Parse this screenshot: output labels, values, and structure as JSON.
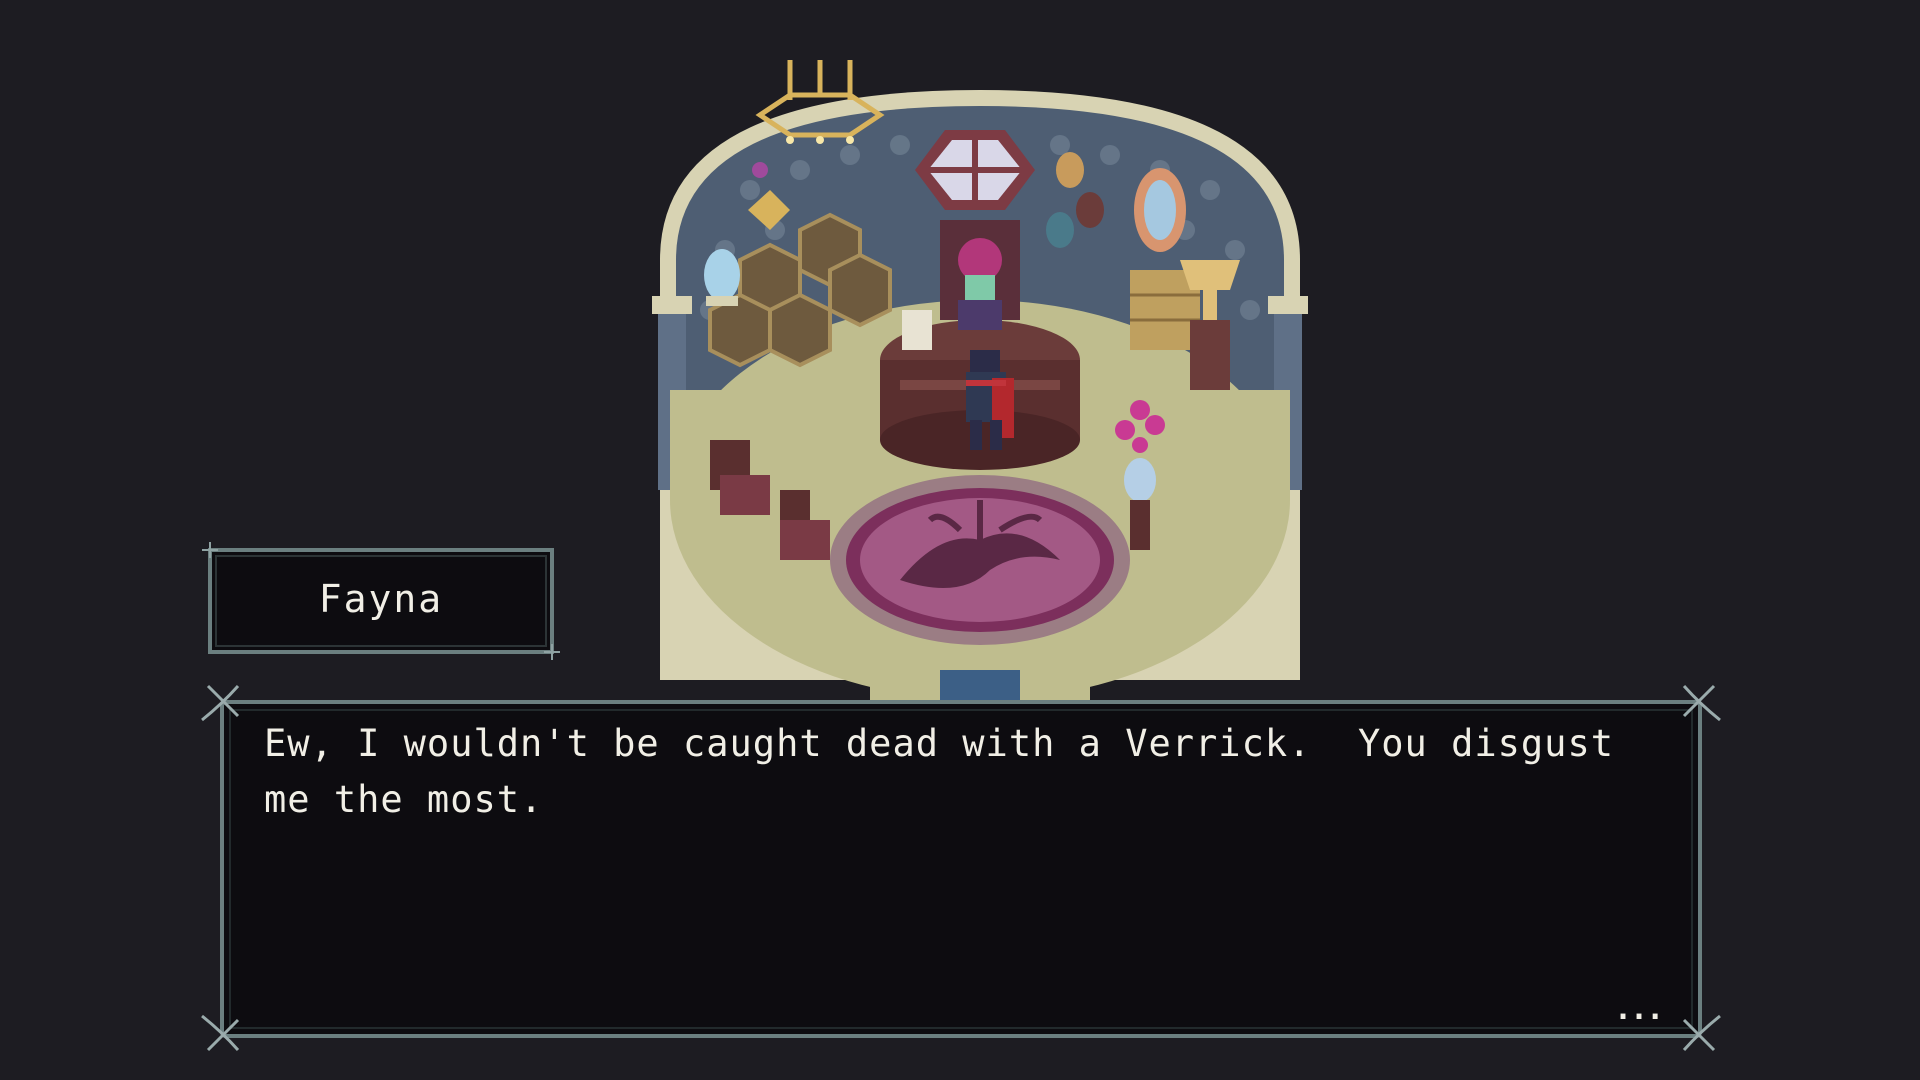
{
  "speaker": {
    "name": "Fayna"
  },
  "dialog": {
    "text": "Ew, I wouldn't be caught dead with a Verrick.  You disgust me the most.",
    "continue_indicator": "..."
  },
  "colors": {
    "background": "#1d1c22",
    "panel_fill": "#0d0c10",
    "panel_border": "#6b7f80",
    "text": "#f1efe6"
  },
  "icons": {
    "continue": "ellipsis-icon"
  }
}
